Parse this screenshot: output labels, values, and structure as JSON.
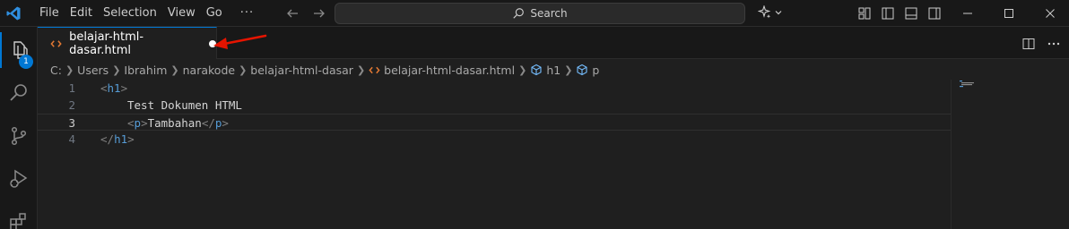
{
  "titlebar": {
    "menu": [
      "File",
      "Edit",
      "Selection",
      "View",
      "Go"
    ],
    "more": "···",
    "search_placeholder": "Search"
  },
  "activity": {
    "items": [
      "explorer-icon",
      "search-icon",
      "source-control-icon",
      "run-debug-icon",
      "extensions-icon"
    ],
    "explorer_badge": "1"
  },
  "tab": {
    "label": "belajar-html-dasar.html",
    "dirty": true
  },
  "breadcrumbs": {
    "items": [
      "C:",
      "Users",
      "Ibrahim",
      "narakode",
      "belajar-html-dasar",
      "belajar-html-dasar.html",
      "h1",
      "p"
    ]
  },
  "editor": {
    "lines": [
      {
        "number": "1",
        "open": "<",
        "tag": "h1",
        "close": ">"
      },
      {
        "number": "2",
        "text": "Test Dokumen HTML"
      },
      {
        "number": "3",
        "p_open_lt": "<",
        "p_tag": "p",
        "p_open_gt": ">",
        "text": "Tambahan",
        "p_close_lt": "</",
        "p_close_tag": "p",
        "p_close_gt": ">"
      },
      {
        "number": "4",
        "open": "</",
        "tag": "h1",
        "close": ">"
      }
    ],
    "current_line": 3
  },
  "colors": {
    "accent": "#0078d4",
    "tag": "#569cd6",
    "bracket": "#808080",
    "html_file_icon": "#e37933",
    "annotation_arrow": "#e51400"
  }
}
